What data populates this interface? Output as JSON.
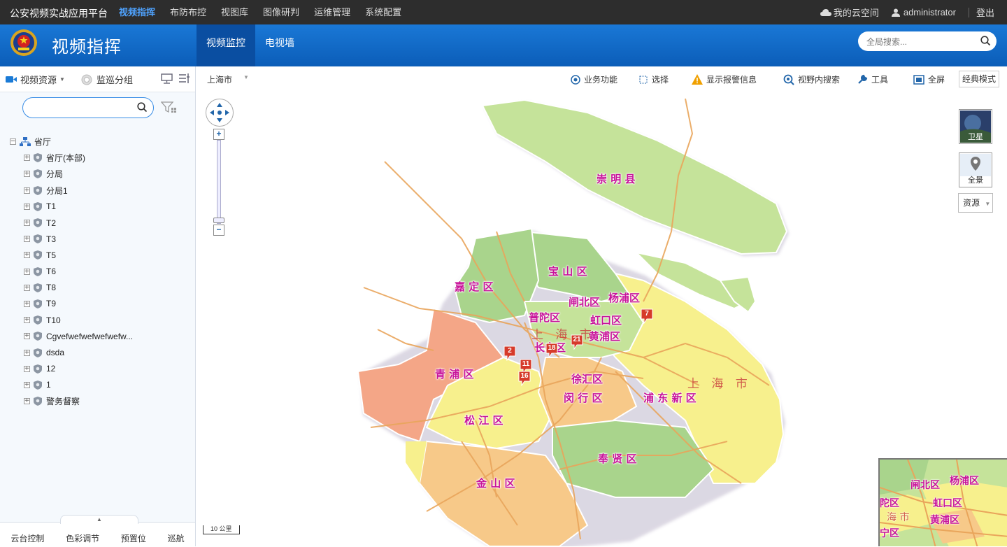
{
  "topbar": {
    "app_title": "公安视频实战应用平台",
    "nav": [
      "视频指挥",
      "布防布控",
      "视图库",
      "图像研判",
      "运维管理",
      "系统配置"
    ],
    "cloud_space": "我的云空间",
    "user": "administrator",
    "logout": "登出"
  },
  "header": {
    "title": "视频指挥",
    "tabs": [
      "视频监控",
      "电视墙"
    ],
    "search_placeholder": "全局搜索..."
  },
  "sidebar": {
    "video_resources": "视频资源",
    "patrol_group": "监巡分组",
    "root": "省厅",
    "tree_items": [
      "省厅(本部)",
      "分局",
      "分局1",
      "T1",
      "T2",
      "T3",
      "T5",
      "T6",
      "T8",
      "T9",
      "T10",
      "Cgvefwefwefwefwefw...",
      "dsda",
      "12",
      "1",
      "警务督察"
    ],
    "bottom_buttons": [
      "云台控制",
      "色彩调节",
      "预置位",
      "巡航"
    ]
  },
  "map_toolbar": {
    "city": "上海市",
    "business": "业务功能",
    "select": "选择",
    "alarm": "显示报警信息",
    "view_search": "视野内搜索",
    "tools": "工具",
    "fullscreen": "全屏",
    "classic_mode": "经典模式"
  },
  "map": {
    "districts": [
      "崇 明 县",
      "宝 山 区",
      "嘉 定 区",
      "闸北区",
      "杨浦区",
      "普陀区",
      "虹口区",
      "黄浦区",
      "长宁区",
      "青 浦 区",
      "徐汇区",
      "闵 行 区",
      "浦 东 新 区",
      "松 江 区",
      "奉 贤 区",
      "金 山 区"
    ],
    "city_labels": [
      "上 海 市",
      "上 海 市"
    ],
    "markers": [
      "7",
      "2",
      "18",
      "21",
      "11",
      "16"
    ],
    "layer_satellite": "卫星",
    "layer_panorama": "全景",
    "resources": "资源",
    "scale": "10 公里",
    "overview_labels": [
      "闸北区",
      "杨浦区",
      "陀区",
      "虹口区",
      "黄浦区",
      "海 市",
      "宁区"
    ],
    "colors": {
      "green_light": "#c5e39a",
      "green": "#a9d48c",
      "yellow": "#f7f08d",
      "salmon": "#f4a687",
      "orange": "#f7c989",
      "road": "#e9a55b",
      "label": "#c8149a"
    }
  }
}
